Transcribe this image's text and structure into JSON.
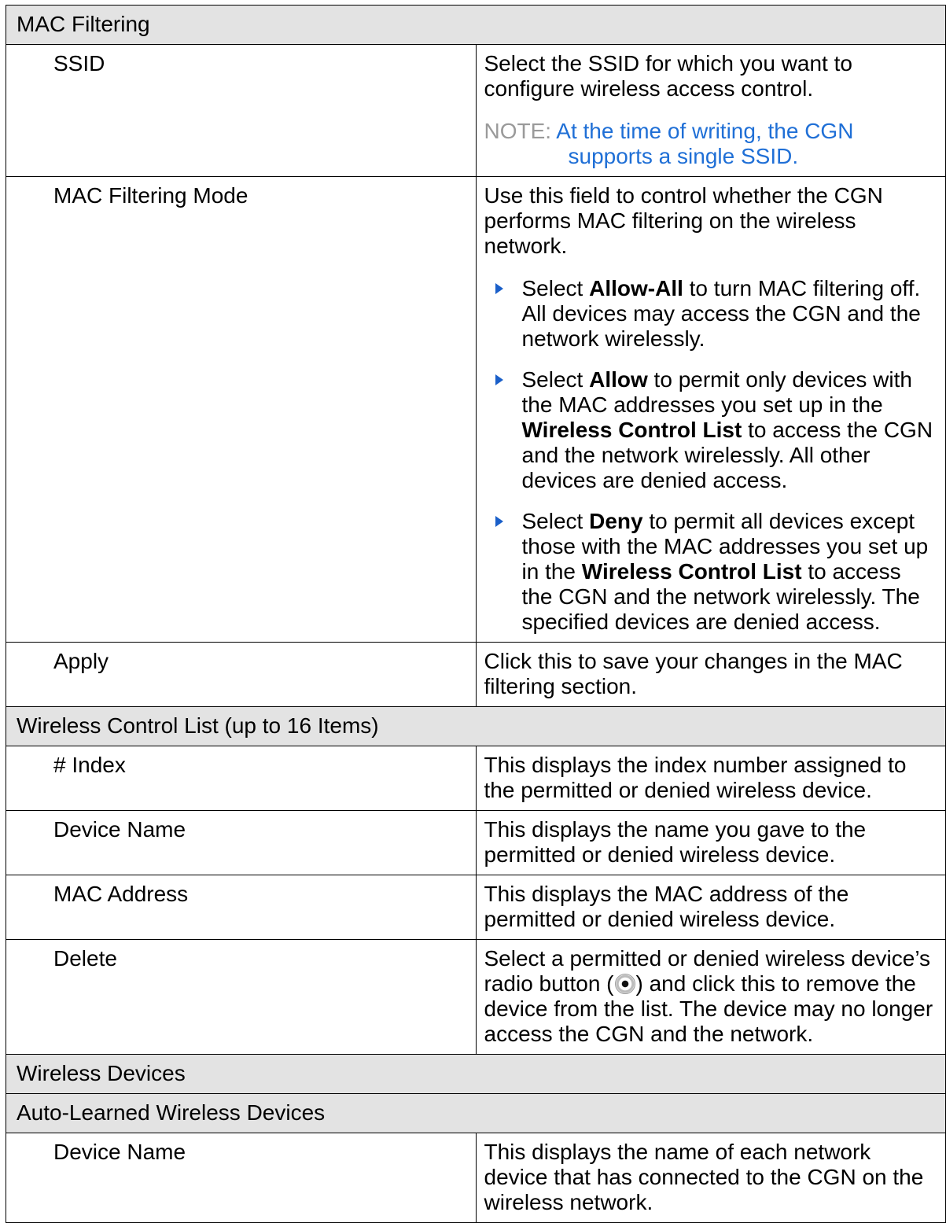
{
  "sections": [
    {
      "title": "MAC Filtering",
      "rows": [
        {
          "label": "SSID",
          "desc": "Select the SSID for which you want to configure wireless access control.",
          "note_label": "NOTE:",
          "note_text": "At the time of writing, the CGN supports a single SSID."
        },
        {
          "label": "MAC Filtering Mode",
          "desc": "Use this field to control whether the CGN performs MAC filtering on the wireless network.",
          "bullets": [
            {
              "pre": "Select ",
              "b1": "Allow-All",
              "mid": " to turn MAC filtering off. All devices may access the CGN and the network wirelessly."
            },
            {
              "pre": "Select ",
              "b1": "Allow",
              "mid": " to permit only devices with the MAC addresses you set up in the ",
              "b2": "Wireless Control List",
              "post": " to access the CGN and the network wirelessly. All other devices are denied access."
            },
            {
              "pre": "Select ",
              "b1": "Deny",
              "mid": " to permit all devices except those with the MAC addresses you set up in the ",
              "b2": "Wireless Control List",
              "post": " to access the CGN and the network wirelessly. The specified devices are denied access."
            }
          ]
        },
        {
          "label": "Apply",
          "desc": "Click this to save your changes in the MAC filtering section."
        }
      ]
    },
    {
      "title": "Wireless Control List (up to 16 Items)",
      "rows": [
        {
          "label": "# Index",
          "desc": "This displays the index number assigned to the permitted or denied wireless device."
        },
        {
          "label": "Device Name",
          "desc": "This displays the name you gave to the permitted or denied wireless device."
        },
        {
          "label": "MAC Address",
          "desc": "This displays the MAC address of the permitted or denied wireless device."
        },
        {
          "label": "Delete",
          "desc_pre": "Select a permitted or denied wireless device’s radio button (",
          "desc_post": ") and click this to remove the device from the list. The device may no longer access the CGN and the network."
        }
      ]
    },
    {
      "title": "Wireless Devices"
    },
    {
      "title": "Auto-Learned Wireless Devices",
      "rows": [
        {
          "label": "Device Name",
          "desc": "This displays the name of each network device that has connected to the CGN on the wireless network."
        }
      ]
    }
  ],
  "icons": {
    "bullet": "triangle-bullet-icon",
    "radio": "radio-button-icon"
  },
  "colors": {
    "section_bg": "#e3e3e3",
    "note_label": "#9a9a9a",
    "note_text": "#1f6fd6",
    "bullet": "#1a5fc9"
  }
}
